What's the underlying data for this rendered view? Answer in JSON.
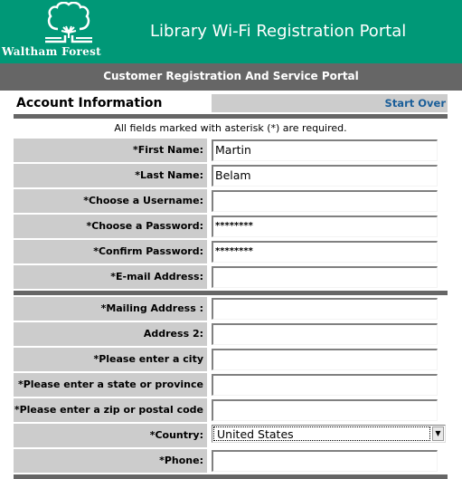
{
  "header": {
    "logo_text": "Waltham Forest",
    "title": "Library Wi-Fi Registration Portal",
    "subtitle": "Customer Registration And Service Portal",
    "brand_color": "#009877"
  },
  "section": {
    "title": "Account Information",
    "start_over_label": "Start Over",
    "required_notice": "All fields marked with asterisk (*) are required."
  },
  "account_fields": [
    {
      "label": "*First Name:",
      "value": "Martin",
      "type": "text"
    },
    {
      "label": "*Last Name:",
      "value": "Belam",
      "type": "text"
    },
    {
      "label": "*Choose a Username:",
      "value": "",
      "type": "text"
    },
    {
      "label": "*Choose a Password:",
      "value": "********",
      "type": "password"
    },
    {
      "label": "*Confirm Password:",
      "value": "********",
      "type": "password"
    },
    {
      "label": "*E-mail Address:",
      "value": "",
      "type": "text"
    }
  ],
  "address_fields": [
    {
      "label": "*Mailing Address :",
      "value": ""
    },
    {
      "label": "Address 2:",
      "value": ""
    },
    {
      "label": "*Please enter a city",
      "value": ""
    },
    {
      "label": "*Please enter a state or province",
      "value": ""
    },
    {
      "label": "*Please enter a zip or postal code",
      "value": ""
    },
    {
      "label": "*Country:",
      "value": "United States",
      "type": "select"
    },
    {
      "label": "*Phone:",
      "value": ""
    }
  ]
}
